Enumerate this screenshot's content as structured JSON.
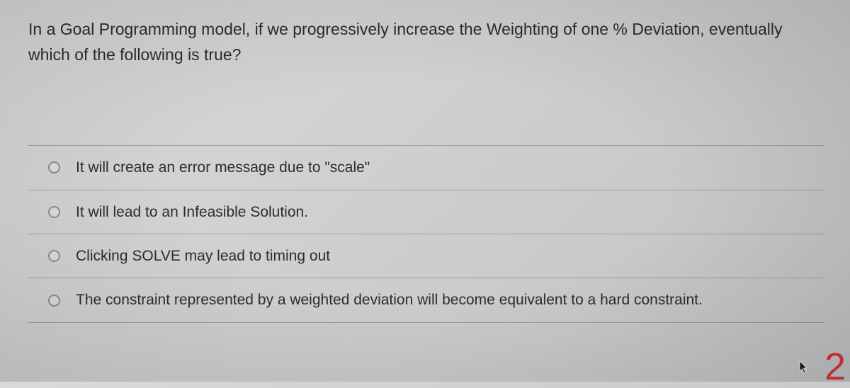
{
  "question": {
    "text": "In a Goal Programming model, if we progressively increase the Weighting of one % Deviation, eventually which of the following is true?"
  },
  "options": [
    {
      "label": "It will create an error message due to \"scale\""
    },
    {
      "label": "It will lead to an Infeasible Solution."
    },
    {
      "label": "Clicking SOLVE may lead to timing out"
    },
    {
      "label": "The constraint represented by a weighted deviation will become equivalent to a hard constraint."
    }
  ],
  "page_number": "2"
}
